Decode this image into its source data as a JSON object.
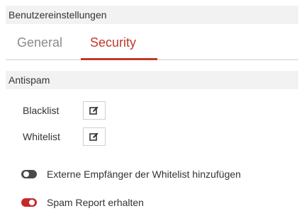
{
  "window": {
    "title": "Benutzereinstellungen"
  },
  "tabs": [
    {
      "label": "General",
      "active": false
    },
    {
      "label": "Security",
      "active": true
    }
  ],
  "section": {
    "title": "Antispam"
  },
  "lists": [
    {
      "label": "Blacklist",
      "action_icon": "edit-icon"
    },
    {
      "label": "Whitelist",
      "action_icon": "edit-icon"
    }
  ],
  "toggles": [
    {
      "label": "Externe Empfänger der Whitelist hinzufügen",
      "enabled": false
    },
    {
      "label": "Spam Report erhalten",
      "enabled": true
    }
  ],
  "colors": {
    "accent": "#c0392b",
    "toggle_on": "#c62828",
    "toggle_off": "#4a4a4a",
    "header_bg": "#f2f2f2"
  }
}
